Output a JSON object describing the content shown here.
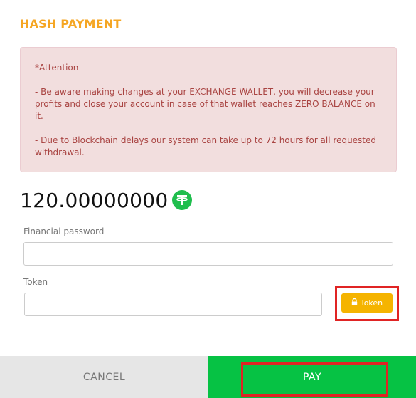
{
  "modal": {
    "title": "HASH PAYMENT"
  },
  "alert": {
    "heading": "*Attention",
    "line1": "- Be aware making changes at your EXCHANGE WALLET, you will decrease your profits and close your account in case of that wallet reaches ZERO BALANCE on it.",
    "line2": "- Due to Blockchain delays our system can take up to 72 hours for all requested withdrawal."
  },
  "amount": {
    "value": "120.00000000",
    "currency_icon": "tether-icon"
  },
  "form": {
    "financial_password_label": "Financial password",
    "financial_password_value": "",
    "token_label": "Token",
    "token_value": "",
    "token_button_label": "Token"
  },
  "footer": {
    "cancel_label": "CANCEL",
    "pay_label": "PAY"
  },
  "colors": {
    "title": "#f5a623",
    "alert_bg": "#f2dede",
    "alert_text": "#a94442",
    "coin": "#1fbe4d",
    "token_button": "#f5b400",
    "pay_button": "#06c244",
    "cancel_button": "#e6e6e6",
    "highlight": "#e02424"
  }
}
